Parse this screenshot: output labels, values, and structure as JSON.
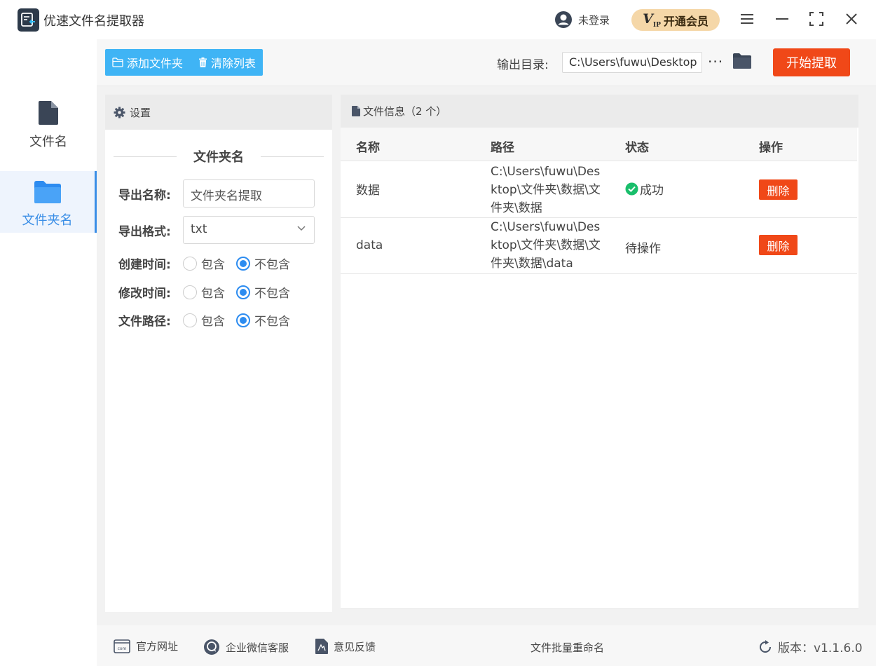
{
  "app": {
    "title": "优速文件名提取器"
  },
  "header": {
    "user_label": "未登录",
    "vip_mark": "V",
    "vip_sub": "IP",
    "vip_label": "开通会员",
    "icons": [
      "user-icon",
      "menu-icon",
      "minimize-icon",
      "maximize-icon",
      "close-icon"
    ]
  },
  "sidebar": {
    "items": [
      {
        "label": "文件名",
        "icon": "file-icon",
        "active": false
      },
      {
        "label": "文件夹名",
        "icon": "folder-icon",
        "active": true
      }
    ]
  },
  "toolbar": {
    "add_folder_label": "添加文件夹",
    "clear_list_label": "清除列表",
    "output_label": "输出目录:",
    "output_path": "C:\\Users\\fuwu\\Desktop",
    "more_label": "···",
    "start_label": "开始提取"
  },
  "settings": {
    "header": "设置",
    "section_title": "文件夹名",
    "export_name_label": "导出名称:",
    "export_name_value": "文件夹名提取",
    "export_format_label": "导出格式:",
    "export_format_value": "txt",
    "radio_rows": [
      {
        "label": "创建时间:",
        "option_include": "包含",
        "option_exclude": "不包含",
        "selected": "不包含"
      },
      {
        "label": "修改时间:",
        "option_include": "包含",
        "option_exclude": "不包含",
        "selected": "不包含"
      },
      {
        "label": "文件路径:",
        "option_include": "包含",
        "option_exclude": "不包含",
        "selected": "不包含"
      }
    ]
  },
  "file_info": {
    "header": "文件信息（2 个）",
    "columns": [
      "名称",
      "路径",
      "状态",
      "操作"
    ],
    "rows": [
      {
        "name": "数据",
        "path": "C:\\Users\\fuwu\\Desktop\\文件夹\\数据\\文件夹\\数据",
        "status": "成功",
        "action": "删除"
      },
      {
        "name": "data",
        "path": "C:\\Users\\fuwu\\Desktop\\文件夹\\数据\\文件夹\\数据\\data",
        "status": "待操作",
        "action": "删除"
      }
    ]
  },
  "footer": {
    "website_label": "官方网址",
    "wechat_label": "企业微信客服",
    "feedback_label": "意见反馈",
    "center_label": "文件批量重命名",
    "version_label": "版本：v1.1.6.0"
  },
  "colors": {
    "accent_blue": "#3fb4f5",
    "start_red": "#f04818",
    "active_blue": "#3a8ee6",
    "vip_gold": "#f5d7a8",
    "success_green": "#19be6b"
  }
}
